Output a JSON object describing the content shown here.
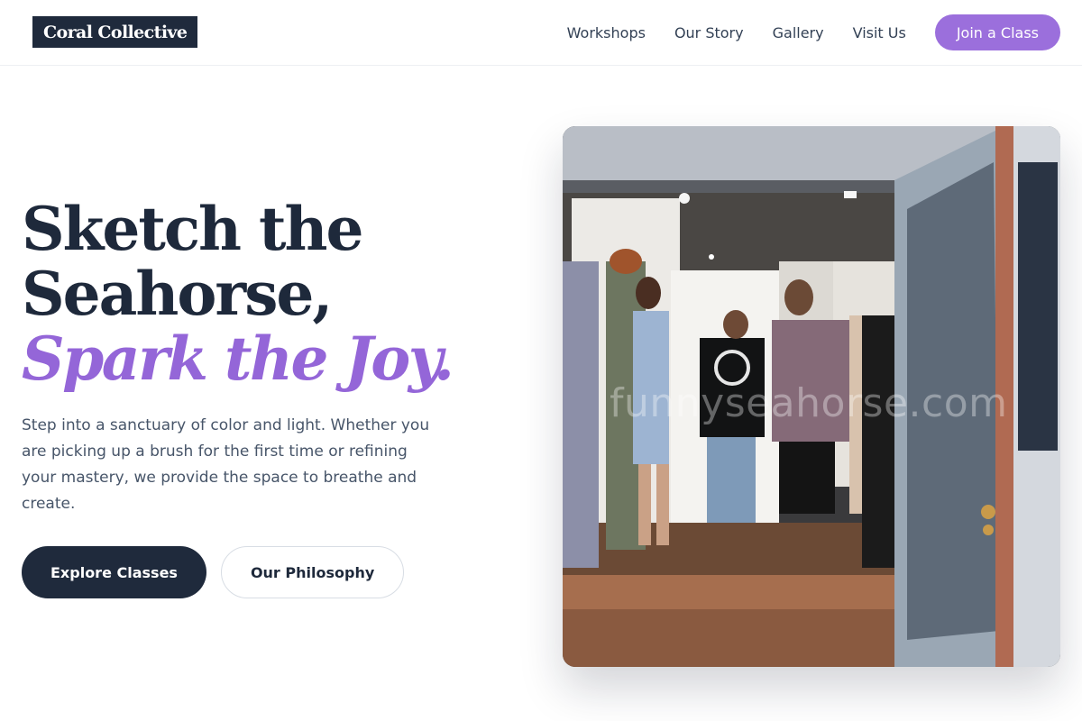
{
  "brand": {
    "logo_text": "Coral Collective"
  },
  "nav": {
    "links": [
      "Workshops",
      "Our Story",
      "Gallery",
      "Visit Us"
    ],
    "cta_label": "Join a Class"
  },
  "hero": {
    "headline_line1": "Sketch the",
    "headline_line2": "Seahorse,",
    "headline_accent": "Spark the Joy.",
    "lede": "Step into a sanctuary of color and light. Whether you are picking up a brush for the first time or refining your mastery, we provide the space to breathe and create.",
    "primary_button": "Explore Classes",
    "secondary_button": "Our Philosophy"
  },
  "photo": {
    "watermark_text": "funnyseahorse.com"
  },
  "colors": {
    "navy": "#1f2a3c",
    "accent_purple": "#9b6fdc",
    "headline_purple": "#9466d8"
  }
}
